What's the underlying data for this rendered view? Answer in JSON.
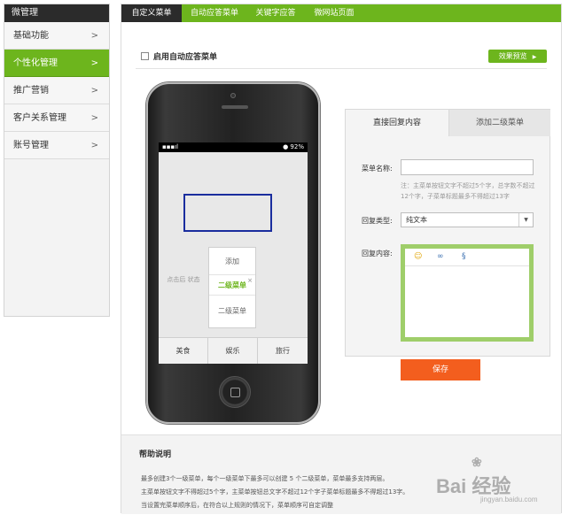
{
  "sidebar": {
    "header": "微管理",
    "items": [
      {
        "label": "基础功能",
        "arrow": ">"
      },
      {
        "label": "个性化管理",
        "arrow": ">"
      },
      {
        "label": "推广营销",
        "arrow": ">"
      },
      {
        "label": "客户关系管理",
        "arrow": ">"
      },
      {
        "label": "账号管理",
        "arrow": ">"
      }
    ],
    "active_index": 1
  },
  "tabs": [
    {
      "label": "自定义菜单"
    },
    {
      "label": "自动应答菜单"
    },
    {
      "label": "关键字应答"
    },
    {
      "label": "微网站页面"
    }
  ],
  "enable_label": "启用自动应答菜单",
  "preview_button": "效果预览",
  "phone": {
    "status_signal": "▪▪▪ıl",
    "status_battery": "● 92%",
    "placeholder": "点击后 状态",
    "submenu": {
      "add": "添加",
      "selected": "二级菜单",
      "other": "二级菜单",
      "close": "×"
    },
    "bottom_menu": [
      "美食",
      "娱乐",
      "旅行"
    ]
  },
  "form": {
    "tabs": [
      "直接回复内容",
      "添加二级菜单"
    ],
    "name_label": "菜单名称:",
    "name_value": "",
    "name_note": "注：主菜单按钮文字不超过5个字，总字数不超过12个字，子菜单标题最多不得超过13字",
    "type_label": "回复类型:",
    "type_value": "纯文本",
    "content_label": "回复内容:",
    "toolbar_icons": [
      "smiley-icon",
      "link-icon",
      "unlink-icon"
    ],
    "save": "保存"
  },
  "help": {
    "title": "帮助说明",
    "lines": [
      "最多创建3个一级菜单，每个一级菜单下最多可以创建 5 个二级菜单，菜单最多支持两层。",
      "主菜单按钮文字不得超过5个字，主菜单按钮总文字不超过12个字子菜单标题最多不得超过13字。",
      "当设置完菜单顺序后，在符合以上规则的情况下，菜单顺序可自定调整"
    ]
  },
  "watermark": {
    "text": "Bai 经验",
    "url": "jingyan.baidu.com"
  },
  "colors": {
    "green": "#6db51d",
    "dark": "#2b2b2b",
    "orange": "#f35e1e",
    "highlight_blue": "#1a2d9e",
    "editor_border": "#9fce6a"
  }
}
